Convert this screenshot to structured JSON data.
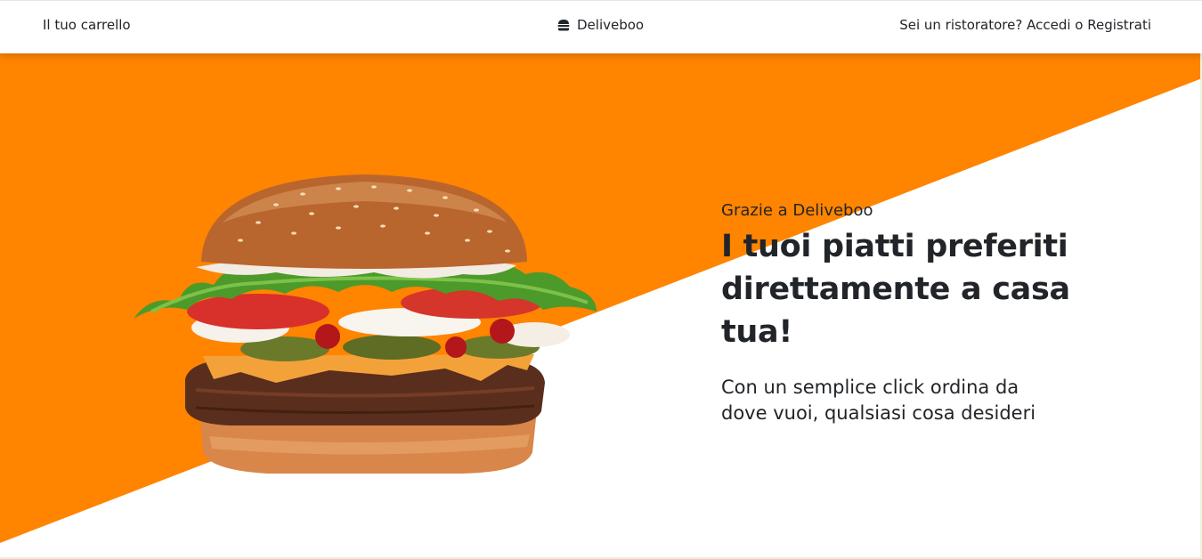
{
  "nav": {
    "cart_label": "Il tuo carrello",
    "brand_icon": "burger-icon",
    "brand_name": "Deliveboo",
    "auth_label": "Sei un ristoratore? Accedi o Registrati"
  },
  "hero": {
    "kicker": "Grazie a Deliveboo",
    "title": "I tuoi piatti preferiti direttamente a casa tua!",
    "subtitle": "Con un semplice click ordina da dove vuoi, qualsiasi cosa desideri",
    "image": "burger-photo"
  },
  "colors": {
    "accent": "#ff8400",
    "text": "#212529",
    "background": "#ffffff"
  }
}
